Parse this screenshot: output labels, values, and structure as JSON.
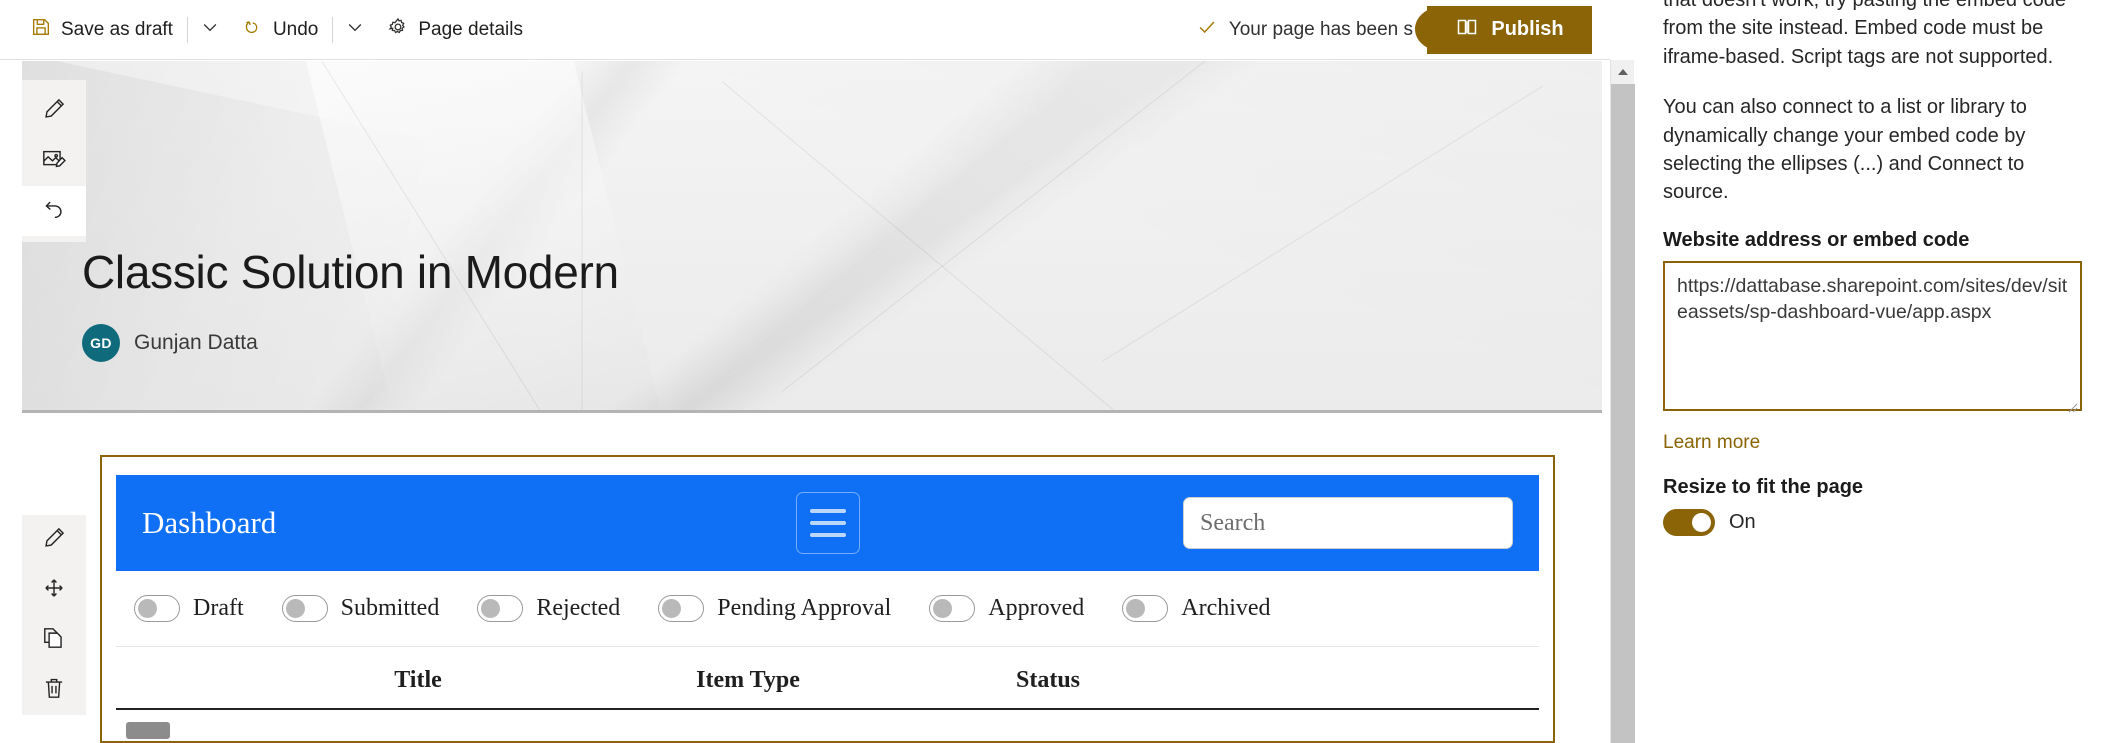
{
  "commandbar": {
    "save_label": "Save as draft",
    "save_icon": "save-floppy-icon",
    "undo_label": "Undo",
    "undo_icon": "undo-arrow-icon",
    "page_details_label": "Page details",
    "page_details_icon": "gear-icon",
    "caret_icon": "chevron-down-icon",
    "status_text": "Your page has been s",
    "status_icon": "checkmark-icon",
    "publish_label": "Publish",
    "publish_icon": "book-icon",
    "publish_color": "#8a6406"
  },
  "hero": {
    "title": "Classic Solution in Modern",
    "author_initials": "GD",
    "author_name": "Gunjan Datta",
    "avatar_color": "#0f6b7b",
    "tools": [
      {
        "name": "edit-pencil-icon",
        "label": "Edit"
      },
      {
        "name": "change-image-icon",
        "label": "Change image"
      },
      {
        "name": "revert-icon",
        "label": "Revert"
      }
    ]
  },
  "webpart_tools": [
    {
      "name": "edit-pencil-icon",
      "label": "Edit web part"
    },
    {
      "name": "move-icon",
      "label": "Move web part"
    },
    {
      "name": "duplicate-icon",
      "label": "Duplicate web part"
    },
    {
      "name": "delete-trash-icon",
      "label": "Delete web part"
    }
  ],
  "add_section_label": "+",
  "dashboard": {
    "title": "Dashboard",
    "header_color": "#1070f5",
    "menu_icon": "hamburger-menu-icon",
    "search_placeholder": "Search",
    "filters": [
      {
        "label": "Draft",
        "on": false
      },
      {
        "label": "Submitted",
        "on": false
      },
      {
        "label": "Rejected",
        "on": false
      },
      {
        "label": "Pending Approval",
        "on": false
      },
      {
        "label": "Approved",
        "on": false
      },
      {
        "label": "Archived",
        "on": false
      }
    ],
    "table": {
      "columns": [
        "",
        "Title",
        "Item Type",
        "Status",
        ""
      ],
      "rows": []
    }
  },
  "property_pane": {
    "paragraphs": [
      "that doesn't work, try pasting the embed code from the site instead. Embed code must be iframe-based. Script tags are not supported.",
      "You can also connect to a list or library to dynamically change your embed code by selecting the ellipses (...) and Connect to source."
    ],
    "address_label": "Website address or embed code",
    "address_value": "https://dattabase.sharepoint.com/sites/dev/siteassets/sp-dashboard-vue/app.aspx",
    "learn_more_label": "Learn more",
    "resize_label": "Resize to fit the page",
    "resize_state": "On",
    "accent_color": "#8a6406"
  },
  "scrollbar": {
    "up_icon": "scroll-up-arrow-icon"
  }
}
